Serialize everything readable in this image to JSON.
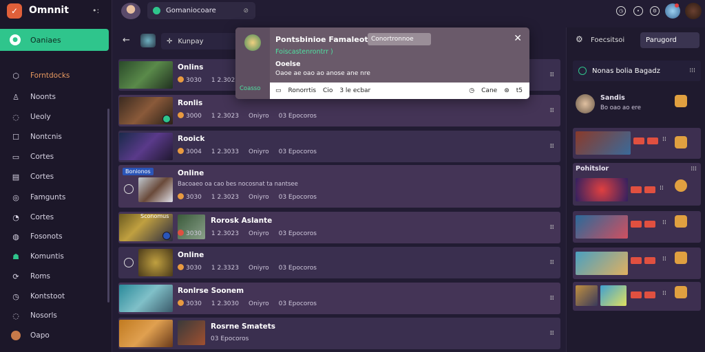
{
  "app": {
    "name": "Omnnit"
  },
  "sidebar": {
    "active": {
      "label": "Oaniaes"
    },
    "items": [
      {
        "label": "Forntdocks",
        "icon": "shield-icon"
      },
      {
        "label": "Noonts",
        "icon": "users-icon"
      },
      {
        "label": "Ueoly",
        "icon": "chat-icon"
      },
      {
        "label": "Nontcnis",
        "icon": "box-icon"
      },
      {
        "label": "Cortes",
        "icon": "document-icon"
      },
      {
        "label": "Cortes",
        "icon": "list-icon"
      },
      {
        "label": "Famgunts",
        "icon": "globe-icon"
      },
      {
        "label": "Cortes",
        "icon": "bell-icon"
      },
      {
        "label": "Fosonots",
        "icon": "star-icon"
      },
      {
        "label": "Komuntis",
        "icon": "users-icon"
      },
      {
        "label": "Roms",
        "icon": "link-icon"
      },
      {
        "label": "Kontstoot",
        "icon": "clock-icon"
      },
      {
        "label": "Nosorls",
        "icon": "settings-icon"
      },
      {
        "label": "Oapo",
        "icon": "avatar-icon"
      }
    ]
  },
  "topbar": {
    "tab_label": "Gomaniocoare",
    "tab_close": "⊘"
  },
  "toolbar": {
    "search_label": "Kunpay"
  },
  "rows": [
    {
      "title": "Onlins",
      "meta": [
        "3030",
        "1 2.3023",
        "",
        ""
      ]
    },
    {
      "title": "Ronlis",
      "meta": [
        "3000",
        "1 2.3023",
        "Oniyro",
        "03 Epocoros"
      ]
    },
    {
      "title": "Rooick",
      "meta": [
        "3004",
        "1 2.3033",
        "Oniyro",
        "03 Epocoros"
      ]
    },
    {
      "title": "Online",
      "tag": "Bonionos",
      "sub": "Bacoaeo oa cao bes nocosnat ta nantsee",
      "meta": [
        "3030",
        "1 2.3023",
        "Oniyro",
        "03 Epocoros"
      ]
    },
    {
      "title": "Rorosk Aslante",
      "tag": "Sconomus",
      "meta": [
        "3030",
        "1 2.3023",
        "Oniyro",
        "03 Epocoros"
      ]
    },
    {
      "title": "Online",
      "meta": [
        "3030",
        "1 2.3323",
        "Oniyro",
        "03 Epocoros"
      ]
    },
    {
      "title": "Ronlrse Soonem",
      "meta": [
        "3030",
        "1 2.3030",
        "Oniyro",
        "03 Epocoros"
      ]
    },
    {
      "title": "Rosrne Smatets",
      "meta": [
        "",
        "",
        "",
        "03 Epocoros"
      ]
    }
  ],
  "popup": {
    "title": "Pontsbinioe Famaleotis",
    "field": "Conortronnoe",
    "subtitle": "Foiscastenrontrr )",
    "heading": "Ooelse",
    "description": "Oaoe ae oao ao anose ane nre",
    "side_label": "Coasso",
    "bar_left": [
      "Ronorrtis",
      "Cio",
      "3 le ecbar"
    ],
    "bar_right": [
      "Cane",
      "",
      "t5"
    ]
  },
  "rpanel": {
    "header_label": "Foecsitsoi",
    "button": "Parugord",
    "section": "Nonas bolia Bagadz",
    "user": {
      "name": "Sandis",
      "sub": "Bo oao ao ere"
    },
    "featured_label": "Pohitslor"
  }
}
